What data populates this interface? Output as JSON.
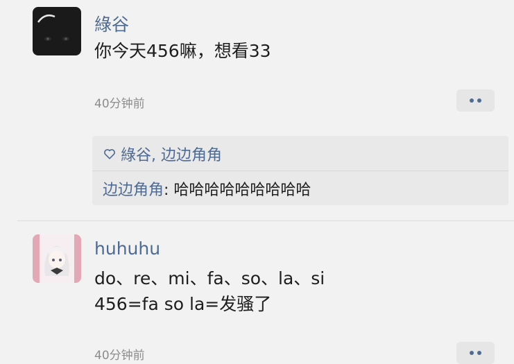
{
  "posts": [
    {
      "username": "綠谷",
      "lines": [
        "你今天456嘛，想看33"
      ],
      "time": "40分钟前",
      "likes": {
        "icon": "heart-outline-icon",
        "names": "綠谷, 边边角角"
      },
      "reply": {
        "author": "边边角角",
        "separator": ": ",
        "text": "哈哈哈哈哈哈哈哈哈"
      },
      "avatar": "black-cat-avatar"
    },
    {
      "username": "huhuhu",
      "lines": [
        "do、re、mi、fa、so、la、si",
        "456=fa so la=发骚了"
      ],
      "time": "40分钟前",
      "avatar": "anime-girl-avatar"
    }
  ],
  "colors": {
    "accent": "#4f6a93",
    "background": "#f2f2f2",
    "reply_bg": "#e9e9e9"
  }
}
